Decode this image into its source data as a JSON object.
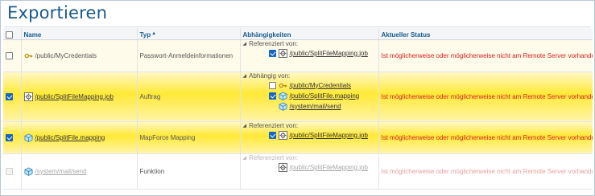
{
  "title": "Exportieren",
  "columns": {
    "name": "Name",
    "type": "Typ",
    "deps": "Abhängigkeiten",
    "status": "Aktueller Status"
  },
  "rows": [
    {
      "checked": false,
      "icon": "key-icon",
      "name": "/public/MyCredentials",
      "type": "Passwort-Anmeldeinformationen",
      "dep_group": "Referenziert von:",
      "dep_items": [
        {
          "checked": true,
          "icon": "gear-mapping-icon",
          "label": "/public/SplitFileMapping.job"
        }
      ],
      "status": "Ist möglicherweise oder möglicherweise nicht am Remote Server vorhanden"
    },
    {
      "checked": true,
      "icon": "gear-mapping-icon",
      "name": "/public/SplitFileMapping.job",
      "type": "Auftrag",
      "dep_group": "Abhängig von:",
      "dep_items": [
        {
          "checked": false,
          "icon": "key-icon",
          "label": "/public/MyCredentials"
        },
        {
          "checked": true,
          "icon": "cube-icon",
          "label": "/public/SplitFile.mapping"
        },
        {
          "checked": null,
          "icon": "cube-icon",
          "label": "/system/mail/send"
        }
      ],
      "status": "Ist möglicherweise oder möglicherweise nicht am Remote Server vorhanden"
    },
    {
      "checked": true,
      "icon": "cube-icon",
      "name": "/public/SplitFile.mapping",
      "type": "MapForce Mapping",
      "dep_group": "Referenziert von:",
      "dep_items": [
        {
          "checked": true,
          "icon": "gear-mapping-icon",
          "label": "/public/SplitFileMapping.job"
        }
      ],
      "status": "Ist möglicherweise oder möglicherweise nicht am Remote Server vorhanden"
    },
    {
      "checked": false,
      "disabled": true,
      "icon": "cube-icon",
      "name": "/system/mail/send",
      "type": "Funktion",
      "dep_group": "Referenziert von:",
      "dep_items": [
        {
          "checked": null,
          "icon": "gear-mapping-icon",
          "label": "/public/SplitFileMapping.job"
        }
      ],
      "status": "Ist möglicherweise oder möglicherweise nicht am Remote Server vorhanden"
    }
  ]
}
